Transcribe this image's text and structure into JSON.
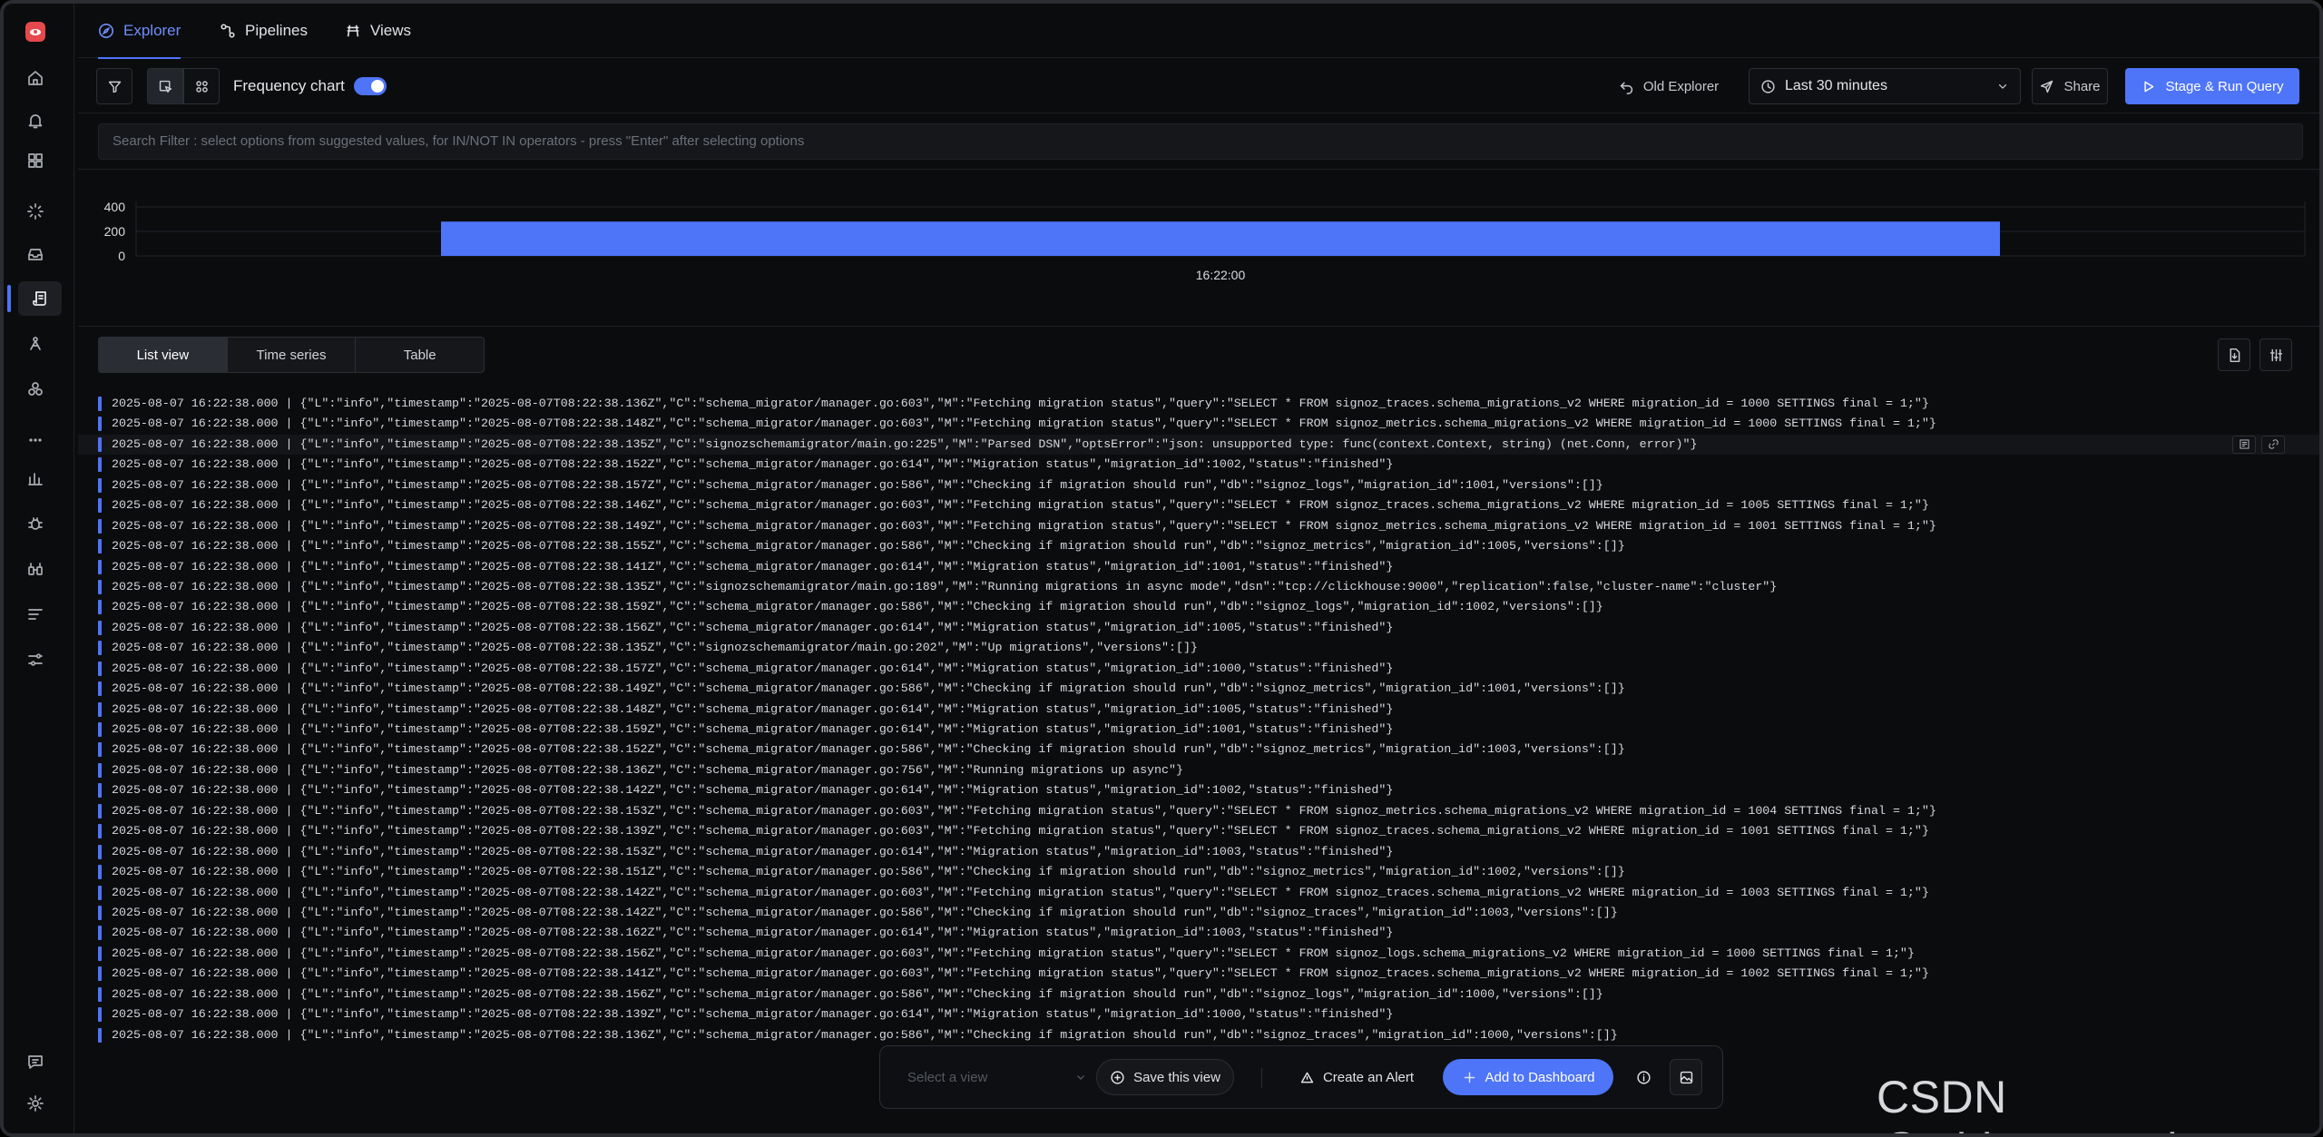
{
  "nav": {
    "tabs": [
      {
        "label": "Explorer",
        "icon": "compass-icon",
        "active": true
      },
      {
        "label": "Pipelines",
        "icon": "pipeline-icon",
        "active": false
      },
      {
        "label": "Views",
        "icon": "views-icon",
        "active": false
      }
    ]
  },
  "sidebar": {
    "items": [
      "home-icon",
      "alerts-icon",
      "dashboards-icon",
      "services-icon",
      "messaging-queues-icon",
      "logs-icon",
      "traces-icon",
      "integrations-icon",
      "more-icon",
      "metrics-icon",
      "exceptions-icon",
      "infra-icon",
      "logs-pipeline-icon",
      "settings-sliders-icon",
      "chat-icon",
      "gear-icon"
    ]
  },
  "toolbar": {
    "frequency_label": "Frequency chart",
    "frequency_enabled": true,
    "old_explorer_label": "Old Explorer",
    "time_range": "Last 30 minutes",
    "share_label": "Share",
    "run_query_label": "Stage & Run Query"
  },
  "search": {
    "placeholder": "Search Filter : select options from suggested values, for IN/NOT IN operators - press \"Enter\" after selecting options"
  },
  "chart_data": {
    "type": "bar",
    "categories": [
      "16:22:00"
    ],
    "values": [
      280
    ],
    "ylim": [
      0,
      400
    ],
    "yticks": [
      "400",
      "200",
      "0"
    ],
    "xlabel": "",
    "ylabel": "",
    "bar_color": "#4e74f8",
    "grid": true
  },
  "view_tabs": [
    {
      "label": "List view",
      "active": true
    },
    {
      "label": "Time series",
      "active": false
    },
    {
      "label": "Table",
      "active": false
    }
  ],
  "logs": [
    "2025-08-07 16:22:38.000 | {\"L\":\"info\",\"timestamp\":\"2025-08-07T08:22:38.136Z\",\"C\":\"schema_migrator/manager.go:603\",\"M\":\"Fetching migration status\",\"query\":\"SELECT * FROM signoz_traces.schema_migrations_v2 WHERE migration_id = 1000 SETTINGS final = 1;\"}",
    "2025-08-07 16:22:38.000 | {\"L\":\"info\",\"timestamp\":\"2025-08-07T08:22:38.148Z\",\"C\":\"schema_migrator/manager.go:603\",\"M\":\"Fetching migration status\",\"query\":\"SELECT * FROM signoz_metrics.schema_migrations_v2 WHERE migration_id = 1000 SETTINGS final = 1;\"}",
    "2025-08-07 16:22:38.000 | {\"L\":\"info\",\"timestamp\":\"2025-08-07T08:22:38.135Z\",\"C\":\"signozschemamigrator/main.go:225\",\"M\":\"Parsed DSN\",\"optsError\":\"json: unsupported type: func(context.Context, string) (net.Conn, error)\"}",
    "2025-08-07 16:22:38.000 | {\"L\":\"info\",\"timestamp\":\"2025-08-07T08:22:38.152Z\",\"C\":\"schema_migrator/manager.go:614\",\"M\":\"Migration status\",\"migration_id\":1002,\"status\":\"finished\"}",
    "2025-08-07 16:22:38.000 | {\"L\":\"info\",\"timestamp\":\"2025-08-07T08:22:38.157Z\",\"C\":\"schema_migrator/manager.go:586\",\"M\":\"Checking if migration should run\",\"db\":\"signoz_logs\",\"migration_id\":1001,\"versions\":[]}",
    "2025-08-07 16:22:38.000 | {\"L\":\"info\",\"timestamp\":\"2025-08-07T08:22:38.146Z\",\"C\":\"schema_migrator/manager.go:603\",\"M\":\"Fetching migration status\",\"query\":\"SELECT * FROM signoz_traces.schema_migrations_v2 WHERE migration_id = 1005 SETTINGS final = 1;\"}",
    "2025-08-07 16:22:38.000 | {\"L\":\"info\",\"timestamp\":\"2025-08-07T08:22:38.149Z\",\"C\":\"schema_migrator/manager.go:603\",\"M\":\"Fetching migration status\",\"query\":\"SELECT * FROM signoz_metrics.schema_migrations_v2 WHERE migration_id = 1001 SETTINGS final = 1;\"}",
    "2025-08-07 16:22:38.000 | {\"L\":\"info\",\"timestamp\":\"2025-08-07T08:22:38.155Z\",\"C\":\"schema_migrator/manager.go:586\",\"M\":\"Checking if migration should run\",\"db\":\"signoz_metrics\",\"migration_id\":1005,\"versions\":[]}",
    "2025-08-07 16:22:38.000 | {\"L\":\"info\",\"timestamp\":\"2025-08-07T08:22:38.141Z\",\"C\":\"schema_migrator/manager.go:614\",\"M\":\"Migration status\",\"migration_id\":1001,\"status\":\"finished\"}",
    "2025-08-07 16:22:38.000 | {\"L\":\"info\",\"timestamp\":\"2025-08-07T08:22:38.135Z\",\"C\":\"signozschemamigrator/main.go:189\",\"M\":\"Running migrations in async mode\",\"dsn\":\"tcp://clickhouse:9000\",\"replication\":false,\"cluster-name\":\"cluster\"}",
    "2025-08-07 16:22:38.000 | {\"L\":\"info\",\"timestamp\":\"2025-08-07T08:22:38.159Z\",\"C\":\"schema_migrator/manager.go:586\",\"M\":\"Checking if migration should run\",\"db\":\"signoz_logs\",\"migration_id\":1002,\"versions\":[]}",
    "2025-08-07 16:22:38.000 | {\"L\":\"info\",\"timestamp\":\"2025-08-07T08:22:38.156Z\",\"C\":\"schema_migrator/manager.go:614\",\"M\":\"Migration status\",\"migration_id\":1005,\"status\":\"finished\"}",
    "2025-08-07 16:22:38.000 | {\"L\":\"info\",\"timestamp\":\"2025-08-07T08:22:38.135Z\",\"C\":\"signozschemamigrator/main.go:202\",\"M\":\"Up migrations\",\"versions\":[]}",
    "2025-08-07 16:22:38.000 | {\"L\":\"info\",\"timestamp\":\"2025-08-07T08:22:38.157Z\",\"C\":\"schema_migrator/manager.go:614\",\"M\":\"Migration status\",\"migration_id\":1000,\"status\":\"finished\"}",
    "2025-08-07 16:22:38.000 | {\"L\":\"info\",\"timestamp\":\"2025-08-07T08:22:38.149Z\",\"C\":\"schema_migrator/manager.go:586\",\"M\":\"Checking if migration should run\",\"db\":\"signoz_metrics\",\"migration_id\":1001,\"versions\":[]}",
    "2025-08-07 16:22:38.000 | {\"L\":\"info\",\"timestamp\":\"2025-08-07T08:22:38.148Z\",\"C\":\"schema_migrator/manager.go:614\",\"M\":\"Migration status\",\"migration_id\":1005,\"status\":\"finished\"}",
    "2025-08-07 16:22:38.000 | {\"L\":\"info\",\"timestamp\":\"2025-08-07T08:22:38.159Z\",\"C\":\"schema_migrator/manager.go:614\",\"M\":\"Migration status\",\"migration_id\":1001,\"status\":\"finished\"}",
    "2025-08-07 16:22:38.000 | {\"L\":\"info\",\"timestamp\":\"2025-08-07T08:22:38.152Z\",\"C\":\"schema_migrator/manager.go:586\",\"M\":\"Checking if migration should run\",\"db\":\"signoz_metrics\",\"migration_id\":1003,\"versions\":[]}",
    "2025-08-07 16:22:38.000 | {\"L\":\"info\",\"timestamp\":\"2025-08-07T08:22:38.136Z\",\"C\":\"schema_migrator/manager.go:756\",\"M\":\"Running migrations up async\"}",
    "2025-08-07 16:22:38.000 | {\"L\":\"info\",\"timestamp\":\"2025-08-07T08:22:38.142Z\",\"C\":\"schema_migrator/manager.go:614\",\"M\":\"Migration status\",\"migration_id\":1002,\"status\":\"finished\"}",
    "2025-08-07 16:22:38.000 | {\"L\":\"info\",\"timestamp\":\"2025-08-07T08:22:38.153Z\",\"C\":\"schema_migrator/manager.go:603\",\"M\":\"Fetching migration status\",\"query\":\"SELECT * FROM signoz_metrics.schema_migrations_v2 WHERE migration_id = 1004 SETTINGS final = 1;\"}",
    "2025-08-07 16:22:38.000 | {\"L\":\"info\",\"timestamp\":\"2025-08-07T08:22:38.139Z\",\"C\":\"schema_migrator/manager.go:603\",\"M\":\"Fetching migration status\",\"query\":\"SELECT * FROM signoz_traces.schema_migrations_v2 WHERE migration_id = 1001 SETTINGS final = 1;\"}",
    "2025-08-07 16:22:38.000 | {\"L\":\"info\",\"timestamp\":\"2025-08-07T08:22:38.153Z\",\"C\":\"schema_migrator/manager.go:614\",\"M\":\"Migration status\",\"migration_id\":1003,\"status\":\"finished\"}",
    "2025-08-07 16:22:38.000 | {\"L\":\"info\",\"timestamp\":\"2025-08-07T08:22:38.151Z\",\"C\":\"schema_migrator/manager.go:586\",\"M\":\"Checking if migration should run\",\"db\":\"signoz_metrics\",\"migration_id\":1002,\"versions\":[]}",
    "2025-08-07 16:22:38.000 | {\"L\":\"info\",\"timestamp\":\"2025-08-07T08:22:38.142Z\",\"C\":\"schema_migrator/manager.go:603\",\"M\":\"Fetching migration status\",\"query\":\"SELECT * FROM signoz_traces.schema_migrations_v2 WHERE migration_id = 1003 SETTINGS final = 1;\"}",
    "2025-08-07 16:22:38.000 | {\"L\":\"info\",\"timestamp\":\"2025-08-07T08:22:38.142Z\",\"C\":\"schema_migrator/manager.go:586\",\"M\":\"Checking if migration should run\",\"db\":\"signoz_traces\",\"migration_id\":1003,\"versions\":[]}",
    "2025-08-07 16:22:38.000 | {\"L\":\"info\",\"timestamp\":\"2025-08-07T08:22:38.162Z\",\"C\":\"schema_migrator/manager.go:614\",\"M\":\"Migration status\",\"migration_id\":1003,\"status\":\"finished\"}",
    "2025-08-07 16:22:38.000 | {\"L\":\"info\",\"timestamp\":\"2025-08-07T08:22:38.156Z\",\"C\":\"schema_migrator/manager.go:603\",\"M\":\"Fetching migration status\",\"query\":\"SELECT * FROM signoz_logs.schema_migrations_v2 WHERE migration_id = 1000 SETTINGS final = 1;\"}",
    "2025-08-07 16:22:38.000 | {\"L\":\"info\",\"timestamp\":\"2025-08-07T08:22:38.141Z\",\"C\":\"schema_migrator/manager.go:603\",\"M\":\"Fetching migration status\",\"query\":\"SELECT * FROM signoz_traces.schema_migrations_v2 WHERE migration_id = 1002 SETTINGS final = 1;\"}",
    "2025-08-07 16:22:38.000 | {\"L\":\"info\",\"timestamp\":\"2025-08-07T08:22:38.156Z\",\"C\":\"schema_migrator/manager.go:586\",\"M\":\"Checking if migration should run\",\"db\":\"signoz_logs\",\"migration_id\":1000,\"versions\":[]}",
    "2025-08-07 16:22:38.000 | {\"L\":\"info\",\"timestamp\":\"2025-08-07T08:22:38.139Z\",\"C\":\"schema_migrator/manager.go:614\",\"M\":\"Migration status\",\"migration_id\":1000,\"status\":\"finished\"}",
    "2025-08-07 16:22:38.000 | {\"L\":\"info\",\"timestamp\":\"2025-08-07T08:22:38.136Z\",\"C\":\"schema_migrator/manager.go:586\",\"M\":\"Checking if migration should run\",\"db\":\"signoz_traces\",\"migration_id\":1000,\"versions\":[]}"
  ],
  "actions": {
    "select_view_placeholder": "Select a view",
    "save_view_label": "Save this view",
    "create_alert_label": "Create an Alert",
    "add_dashboard_label": "Add to Dashboard"
  },
  "watermark": "CSDN @whiteBrocade"
}
